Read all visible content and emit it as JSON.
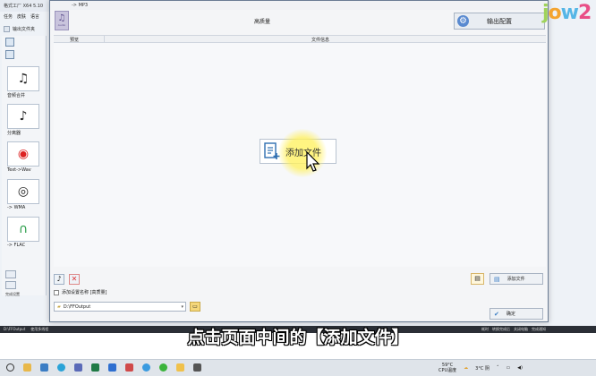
{
  "main_window": {
    "title": "格式工厂 X64 5.10",
    "menu": [
      "任务",
      "皮肤",
      "语言"
    ],
    "output_folder_label": "输出文件夹",
    "tools": [
      {
        "label": "音频合并",
        "icon": "music-merge-icon"
      },
      {
        "label": "分离器",
        "icon": "splitter-icon"
      },
      {
        "label": "Text->Wav",
        "icon": "text-speech-icon"
      },
      {
        "label": "-> WMA",
        "icon": "wma-icon"
      },
      {
        "label": "-> FLAC",
        "icon": "flac-icon"
      }
    ],
    "bottom_label": "完成设置"
  },
  "dialog": {
    "title": "-> MP3",
    "thumb_label": "Audio",
    "profile_title": "高质量",
    "output_config_label": "输出配置",
    "columns": [
      "预览",
      "文件信息"
    ],
    "add_file_center": "添加文件",
    "name_checkbox_label": "添加设置名称 [高质量]",
    "output_path": "D:\\FFOutput",
    "add_file_button": "添加文件",
    "ok_button": "确定"
  },
  "subtitle": "点击页面中间的【添加文件】",
  "status": {
    "left_path": "D:\\FFOutput",
    "left_option": "使用多线程",
    "elapsed": "耗时",
    "after_convert": "转换完成后",
    "shutdown": "关闭电脑",
    "notify": "完成通知"
  },
  "taskbar": {
    "temperature": "59°C",
    "cpu_label": "CPU温度",
    "weather": "3°C 阴",
    "app_icons": [
      "search-icon",
      "file-explorer-icon",
      "store-icon",
      "edge-icon",
      "photos-icon",
      "excel-icon",
      "mail-icon",
      "music-icon",
      "chat-icon",
      "wechat-icon",
      "folder-icon",
      "app-icon"
    ]
  },
  "logo": {
    "letters": [
      "j",
      "o",
      "w",
      "2"
    ]
  },
  "colors": {
    "accent_blue": "#3b7dc4",
    "highlight_yellow": "#fff07a",
    "logo_green": "#9fd35a",
    "logo_orange": "#f4a42f",
    "logo_blue": "#55b6e6",
    "logo_pink": "#e94e86"
  }
}
